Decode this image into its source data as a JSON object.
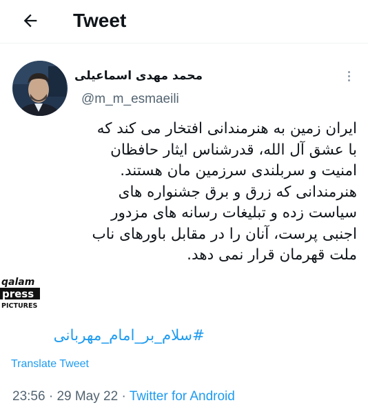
{
  "header": {
    "title": "Tweet"
  },
  "author": {
    "display_name": "محمد مهدی اسماعیلی",
    "username": "@m_m_esmaeili"
  },
  "tweet": {
    "lines": [
      "ایران زمین به هنرمندانی افتخار می کند که",
      "با عشق آل الله، قدرشناس ایثار حافظان",
      "امنیت و سربلندی سرزمین مان هستند.",
      "هنرمندانی که زرق و برق جشنواره های",
      "سیاست زده و تبلیغات رسانه های مزدور",
      "اجنبی پرست، آنان را در مقابل باورهای ناب",
      "ملت قهرمان قرار نمی دهد."
    ],
    "hashtag": "#سلام_بر_امام_مهربانی"
  },
  "translate_label": "Translate Tweet",
  "meta": {
    "time": "23:56",
    "date": "29 May 22",
    "source": "Twitter for Android"
  },
  "watermark": {
    "line1": "qalam",
    "line2": "press",
    "line3": "PICTURES"
  },
  "icons": {
    "back": "arrow-left-icon",
    "more": "more-vertical-icon"
  },
  "colors": {
    "accent": "#1d9bf0",
    "secondary_text": "#536471",
    "primary_text": "#0f1419"
  }
}
